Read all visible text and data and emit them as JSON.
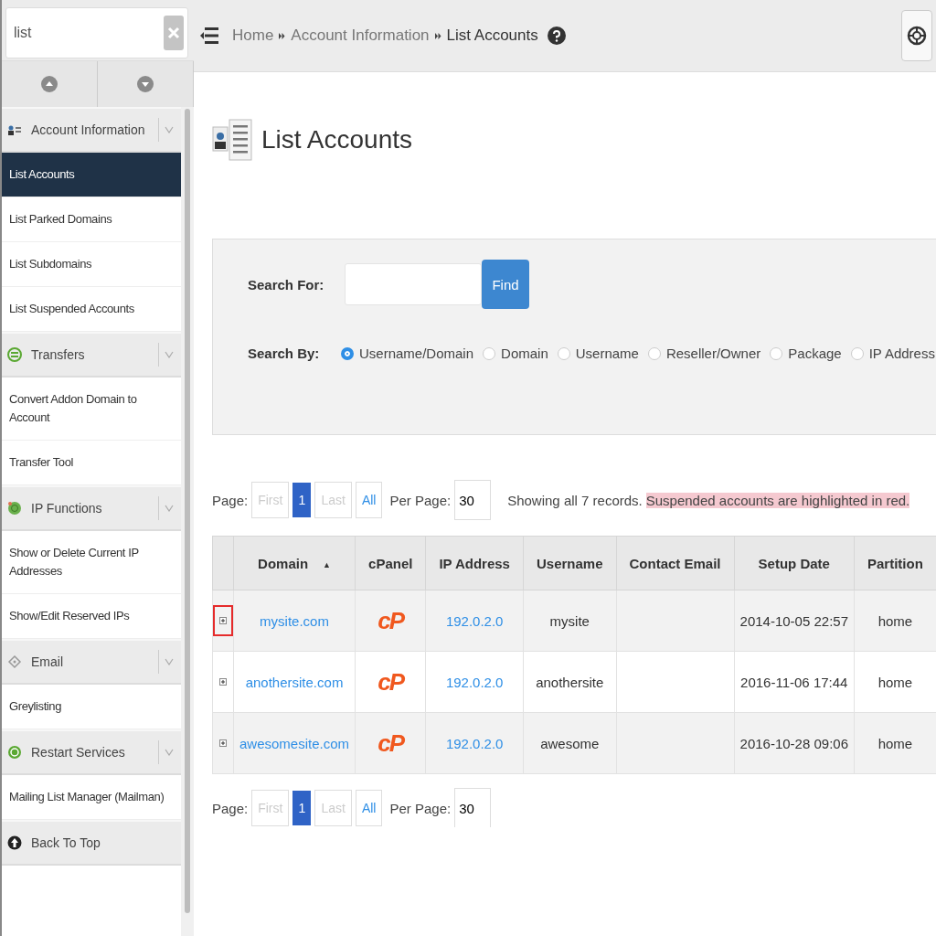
{
  "sidebar": {
    "search": {
      "value": "list"
    },
    "groups": [
      {
        "label": "Account Information",
        "items": [
          {
            "label": "List Accounts",
            "selected": true
          },
          {
            "label": "List Parked Domains",
            "selected": false
          },
          {
            "label": "List Subdomains",
            "selected": false
          },
          {
            "label": "List Suspended Accounts",
            "selected": false
          }
        ]
      },
      {
        "label": "Transfers",
        "items": [
          {
            "label": "Convert Addon Domain to Account",
            "selected": false
          },
          {
            "label": "Transfer Tool",
            "selected": false
          }
        ]
      },
      {
        "label": "IP Functions",
        "items": [
          {
            "label": "Show or Delete Current IP Addresses",
            "selected": false
          },
          {
            "label": "Show/Edit Reserved IPs",
            "selected": false
          }
        ]
      },
      {
        "label": "Email",
        "items": [
          {
            "label": "Greylisting",
            "selected": false
          }
        ]
      },
      {
        "label": "Restart Services",
        "items": [
          {
            "label": "Mailing List Manager (Mailman)",
            "selected": false
          }
        ]
      }
    ],
    "back_to_top": "Back To Top"
  },
  "breadcrumb": [
    {
      "label": "Home",
      "current": false
    },
    {
      "label": "Account Information",
      "current": false
    },
    {
      "label": "List Accounts",
      "current": true
    }
  ],
  "page_title": "List Accounts",
  "search_panel": {
    "search_for_label": "Search For:",
    "find_button": "Find",
    "search_by_label": "Search By:",
    "options": [
      {
        "label": "Username/Domain",
        "selected": true
      },
      {
        "label": "Domain",
        "selected": false
      },
      {
        "label": "Username",
        "selected": false
      },
      {
        "label": "Reseller/Owner",
        "selected": false
      },
      {
        "label": "Package",
        "selected": false
      },
      {
        "label": "IP Address",
        "selected": false
      }
    ]
  },
  "pagination_top": {
    "label": "Page:",
    "pages": [
      {
        "label": "First",
        "disabled": true,
        "selected": false
      },
      {
        "label": "1",
        "disabled": false,
        "selected": true
      },
      {
        "label": "Last",
        "disabled": true,
        "selected": false
      },
      {
        "label": "All",
        "disabled": false,
        "selected": false
      }
    ],
    "per_page_label": "Per Page:",
    "per_page": "30"
  },
  "summary": "Showing all 7 records.",
  "notice": "Suspended accounts are highlighted in red.",
  "table": {
    "columns": [
      {
        "label": "Domain",
        "sort": "▲"
      },
      {
        "label": "cPanel"
      },
      {
        "label": "IP Address"
      },
      {
        "label": "Username"
      },
      {
        "label": "Contact Email"
      },
      {
        "label": "Setup Date"
      },
      {
        "label": "Partition"
      }
    ],
    "rows": [
      {
        "highlighted": true,
        "domain": "mysite.com",
        "cpanel": "cP",
        "ip": "192.0.2.0",
        "username": "mysite",
        "setup_date": "2014-10-05 22:57",
        "partition": "home"
      },
      {
        "highlighted": false,
        "domain": "anothersite.com",
        "cpanel": "cP",
        "ip": "192.0.2.0",
        "username": "anothersite",
        "setup_date": "2016-11-06 17:44",
        "partition": "home"
      },
      {
        "highlighted": false,
        "domain": "awesomesite.com",
        "cpanel": "cP",
        "ip": "192.0.2.0",
        "username": "awesome",
        "setup_date": "2016-10-28 09:06",
        "partition": "home"
      }
    ]
  },
  "pagination_bottom": {
    "label": "Page:",
    "pages": [
      {
        "label": "First",
        "disabled": true,
        "selected": false
      },
      {
        "label": "1",
        "disabled": false,
        "selected": true
      },
      {
        "label": "Last",
        "disabled": true,
        "selected": false
      },
      {
        "label": "All",
        "disabled": false,
        "selected": false
      }
    ],
    "per_page_label": "Per Page:",
    "per_page": "30"
  }
}
